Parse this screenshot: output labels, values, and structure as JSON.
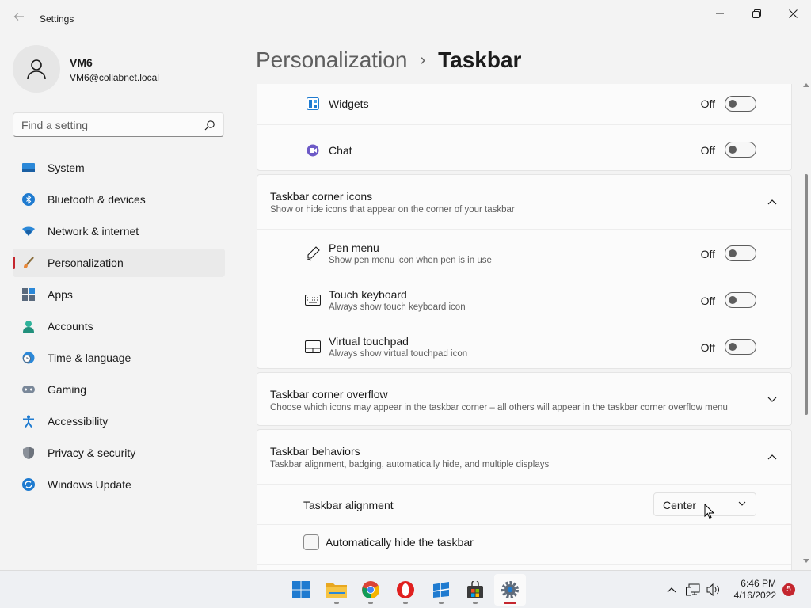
{
  "window": {
    "title": "Settings",
    "back_icon": "arrow-left-icon",
    "minimize_icon": "minimize-icon",
    "maximize_icon": "restore-icon",
    "close_icon": "close-icon"
  },
  "profile": {
    "name": "VM6",
    "email": "VM6@collabnet.local",
    "avatar_icon": "person-icon"
  },
  "search": {
    "placeholder": "Find a setting",
    "icon": "search-icon"
  },
  "sidebar": {
    "accent": "#c4262e",
    "items": [
      {
        "label": "System",
        "icon": "monitor-icon",
        "selected": false
      },
      {
        "label": "Bluetooth & devices",
        "icon": "bluetooth-icon",
        "selected": false
      },
      {
        "label": "Network & internet",
        "icon": "wifi-icon",
        "selected": false
      },
      {
        "label": "Personalization",
        "icon": "brush-icon",
        "selected": true
      },
      {
        "label": "Apps",
        "icon": "apps-icon",
        "selected": false
      },
      {
        "label": "Accounts",
        "icon": "account-icon",
        "selected": false
      },
      {
        "label": "Time & language",
        "icon": "clock-globe-icon",
        "selected": false
      },
      {
        "label": "Gaming",
        "icon": "gamepad-icon",
        "selected": false
      },
      {
        "label": "Accessibility",
        "icon": "accessibility-icon",
        "selected": false
      },
      {
        "label": "Privacy & security",
        "icon": "shield-icon",
        "selected": false
      },
      {
        "label": "Windows Update",
        "icon": "update-icon",
        "selected": false
      }
    ]
  },
  "header": {
    "parent": "Personalization",
    "separator": "›",
    "current": "Taskbar"
  },
  "taskbar_items": {
    "widgets": {
      "label": "Widgets",
      "state": "Off",
      "icon": "widgets-icon"
    },
    "chat": {
      "label": "Chat",
      "state": "Off",
      "icon": "chat-icon"
    }
  },
  "corner_icons": {
    "title": "Taskbar corner icons",
    "subtitle": "Show or hide icons that appear on the corner of your taskbar",
    "expanded": true,
    "items": [
      {
        "title": "Pen menu",
        "subtitle": "Show pen menu icon when pen is in use",
        "state": "Off",
        "icon": "pen-icon"
      },
      {
        "title": "Touch keyboard",
        "subtitle": "Always show touch keyboard icon",
        "state": "Off",
        "icon": "keyboard-icon"
      },
      {
        "title": "Virtual touchpad",
        "subtitle": "Always show virtual touchpad icon",
        "state": "Off",
        "icon": "touchpad-icon"
      }
    ]
  },
  "corner_overflow": {
    "title": "Taskbar corner overflow",
    "subtitle": "Choose which icons may appear in the taskbar corner – all others will appear in the taskbar corner overflow menu",
    "expanded": false
  },
  "behaviors": {
    "title": "Taskbar behaviors",
    "subtitle": "Taskbar alignment, badging, automatically hide, and multiple displays",
    "expanded": true,
    "alignment_label": "Taskbar alignment",
    "alignment_value": "Center",
    "autohide_label": "Automatically hide the taskbar",
    "autohide_checked": false
  },
  "system_taskbar": {
    "apps": [
      {
        "name": "start",
        "icon": "windows-start-icon",
        "running": false
      },
      {
        "name": "file-explorer",
        "icon": "folder-icon",
        "running": true
      },
      {
        "name": "chrome",
        "icon": "chrome-icon",
        "running": true
      },
      {
        "name": "opera",
        "icon": "opera-icon",
        "running": true
      },
      {
        "name": "sticky-app",
        "icon": "blue-app-icon",
        "running": true
      },
      {
        "name": "store",
        "icon": "store-icon",
        "running": true
      },
      {
        "name": "settings",
        "icon": "settings-gear-icon",
        "running": true,
        "active": true
      }
    ],
    "time": "6:46 PM",
    "date": "4/16/2022",
    "notification_count": "5",
    "tray_icons": [
      "chevron-up-icon",
      "network-icon",
      "volume-icon"
    ]
  }
}
